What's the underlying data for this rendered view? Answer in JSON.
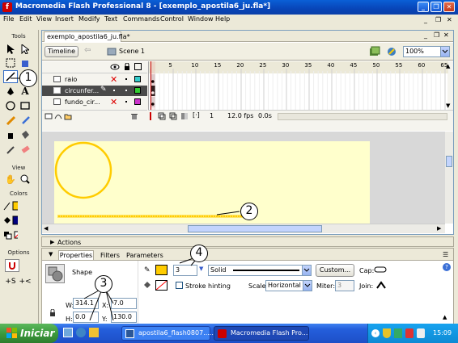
{
  "window": {
    "title": "Macromedia Flash Professional 8 - [exemplo_apostila6_ju.fla*]"
  },
  "menu": [
    "File",
    "Edit",
    "View",
    "Insert",
    "Modify",
    "Text",
    "Commands",
    "Control",
    "Window",
    "Help"
  ],
  "tools_panel": {
    "tools_label": "Tools",
    "view_label": "View",
    "colors_label": "Colors",
    "options_label": "Options"
  },
  "document": {
    "tab": "exemplo_apostila6_ju.fla*",
    "timeline_button": "Timeline",
    "scene": "Scene 1",
    "zoom": "100%",
    "layers": [
      {
        "name": "raio"
      },
      {
        "name": "circunfer..."
      },
      {
        "name": "fundo_cir..."
      }
    ],
    "frame_ruler": [
      "5",
      "10",
      "15",
      "20",
      "25",
      "30",
      "35",
      "40",
      "45",
      "50",
      "55",
      "60",
      "65"
    ],
    "frame_number": "1",
    "fps": "12.0 fps",
    "time": "0.0s"
  },
  "actions_panel": {
    "label": "Actions"
  },
  "properties_panel": {
    "tabs": [
      "Properties",
      "Filters",
      "Parameters"
    ],
    "shape_label": "Shape",
    "stroke_height": "3",
    "stroke_style": "Solid",
    "custom_button": "Custom...",
    "cap_label": "Cap:",
    "stroke_hinting_label": "Stroke hinting",
    "scale_label": "Scale:",
    "scale_value": "Horizontal",
    "miter_label": "Miter:",
    "miter_value": "3",
    "join_label": "Join:",
    "w_label": "W:",
    "w_value": "314.1",
    "x_label": "X:",
    "x_value": "7.0",
    "h_label": "H:",
    "h_value": "0.0",
    "y_label": "Y:",
    "y_value": "130.0"
  },
  "callouts": [
    "1",
    "2",
    "3",
    "4"
  ],
  "taskbar": {
    "start": "Iniciar",
    "items": [
      "apostila6_flash0807.....",
      "Macromedia Flash Pro..."
    ],
    "clock": "15:09"
  },
  "colors": {
    "stage": "#ffffcc",
    "stroke": "#ffcc00",
    "titlebar": "#0a5fd6",
    "taskbar": "#245edb",
    "start": "#3c9a3c"
  }
}
